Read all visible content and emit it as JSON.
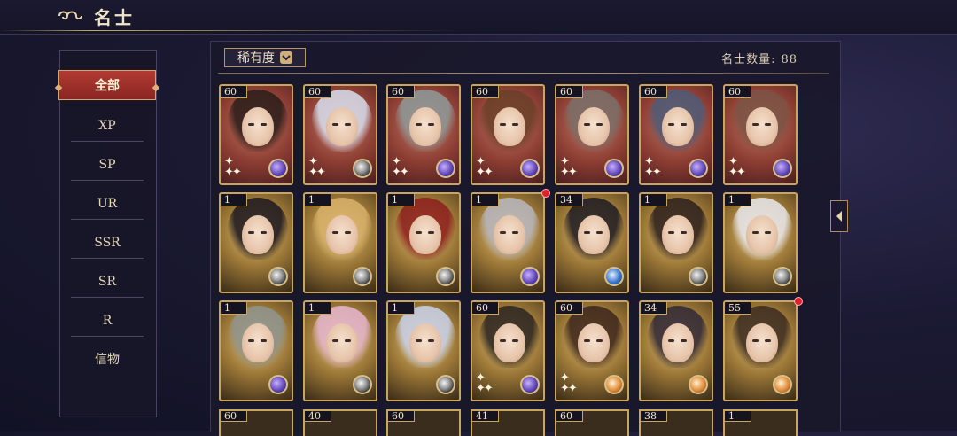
{
  "header": {
    "title": "名士",
    "title_icon": "cloud-swirl-icon"
  },
  "sidebar": {
    "items": [
      {
        "label": "全部",
        "active": true
      },
      {
        "label": "XP"
      },
      {
        "label": "SP"
      },
      {
        "label": "UR"
      },
      {
        "label": "SSR"
      },
      {
        "label": "SR"
      },
      {
        "label": "R"
      },
      {
        "label": "信物"
      }
    ]
  },
  "toolbar": {
    "filter_label": "稀有度",
    "count_label": "名士数量:",
    "count_value": "88"
  },
  "rows": [
    [
      {
        "level": "60",
        "bg": "red",
        "hair": "#2a1d1a",
        "badge": "purple",
        "sparkle": true
      },
      {
        "level": "60",
        "bg": "red",
        "hair": "#d7dff0",
        "badge": "gray",
        "sparkle": true
      },
      {
        "level": "60",
        "bg": "red",
        "hair": "#8e9a9a",
        "badge": "purple",
        "sparkle": true
      },
      {
        "level": "60",
        "bg": "red",
        "hair": "#6a3f29",
        "badge": "purple",
        "sparkle": true
      },
      {
        "level": "60",
        "bg": "red",
        "hair": "#7a6f6a",
        "badge": "purple",
        "sparkle": true
      },
      {
        "level": "60",
        "bg": "red",
        "hair": "#4c5a78",
        "badge": "purple",
        "sparkle": true
      },
      {
        "level": "60",
        "bg": "red",
        "hair": "#7a5345",
        "badge": "purple",
        "sparkle": true
      }
    ],
    [
      {
        "level": "1",
        "bg": "gold",
        "hair": "#1c1720",
        "badge": "gray"
      },
      {
        "level": "1",
        "bg": "gold",
        "hair": "#d8b16a",
        "badge": "gray"
      },
      {
        "level": "1",
        "bg": "gold",
        "hair": "#8c1e1c",
        "badge": "gray"
      },
      {
        "level": "1",
        "bg": "gold",
        "hair": "#b7b7bf",
        "badge": "purple",
        "dot": true
      },
      {
        "level": "34",
        "bg": "gold",
        "hair": "#1d1a22",
        "badge": "blue"
      },
      {
        "level": "1",
        "bg": "gold",
        "hair": "#2b1e1c",
        "badge": "gray"
      },
      {
        "level": "1",
        "bg": "gold",
        "hair": "#e8e8ee",
        "badge": "gray"
      }
    ],
    [
      {
        "level": "1",
        "bg": "gold",
        "hair": "#8e9490",
        "badge": "purple"
      },
      {
        "level": "1",
        "bg": "gold",
        "hair": "#e6b6d0",
        "badge": "gray"
      },
      {
        "level": "1",
        "bg": "gold",
        "hair": "#c9d3ec",
        "badge": "gray"
      },
      {
        "level": "60",
        "bg": "gold",
        "hair": "#2a2420",
        "badge": "purple",
        "sparkle": true
      },
      {
        "level": "60",
        "bg": "gold",
        "hair": "#3b251b",
        "badge": "orange",
        "sparkle": true
      },
      {
        "level": "34",
        "bg": "gold",
        "hair": "#2f2736",
        "badge": "orange"
      },
      {
        "level": "55",
        "bg": "gold",
        "hair": "#3a2a20",
        "badge": "orange",
        "dot": true
      }
    ]
  ],
  "bottom_row": [
    "60",
    "40",
    "60",
    "41",
    "60",
    "38",
    "1"
  ]
}
